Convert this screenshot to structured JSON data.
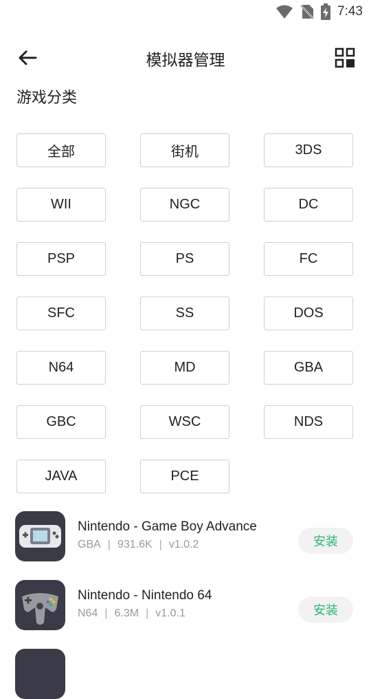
{
  "status_bar": {
    "time": "7:43",
    "icons": [
      "wifi-icon",
      "no-sim-icon",
      "battery-charging-icon"
    ]
  },
  "header": {
    "title": "模拟器管理",
    "back_icon": "arrow-left-icon",
    "grid_icon": "grid-view-icon"
  },
  "section_title": "游戏分类",
  "categories": [
    "全部",
    "街机",
    "3DS",
    "WII",
    "NGC",
    "DC",
    "PSP",
    "PS",
    "FC",
    "SFC",
    "SS",
    "DOS",
    "N64",
    "MD",
    "GBA",
    "GBC",
    "WSC",
    "NDS",
    "JAVA",
    "PCE"
  ],
  "apps": [
    {
      "name": "Nintendo - Game Boy Advance",
      "platform": "GBA",
      "size": "931.6K",
      "version": "v1.0.2",
      "install_label": "安装",
      "icon": "gba-console-icon"
    },
    {
      "name": "Nintendo - Nintendo 64",
      "platform": "N64",
      "size": "6.3M",
      "version": "v1.0.1",
      "install_label": "安装",
      "icon": "n64-controller-icon"
    }
  ],
  "colors": {
    "accent": "#2bb673",
    "icon_bg": "#3b3a47",
    "meta_text": "#999999"
  },
  "meta_separator": "|"
}
